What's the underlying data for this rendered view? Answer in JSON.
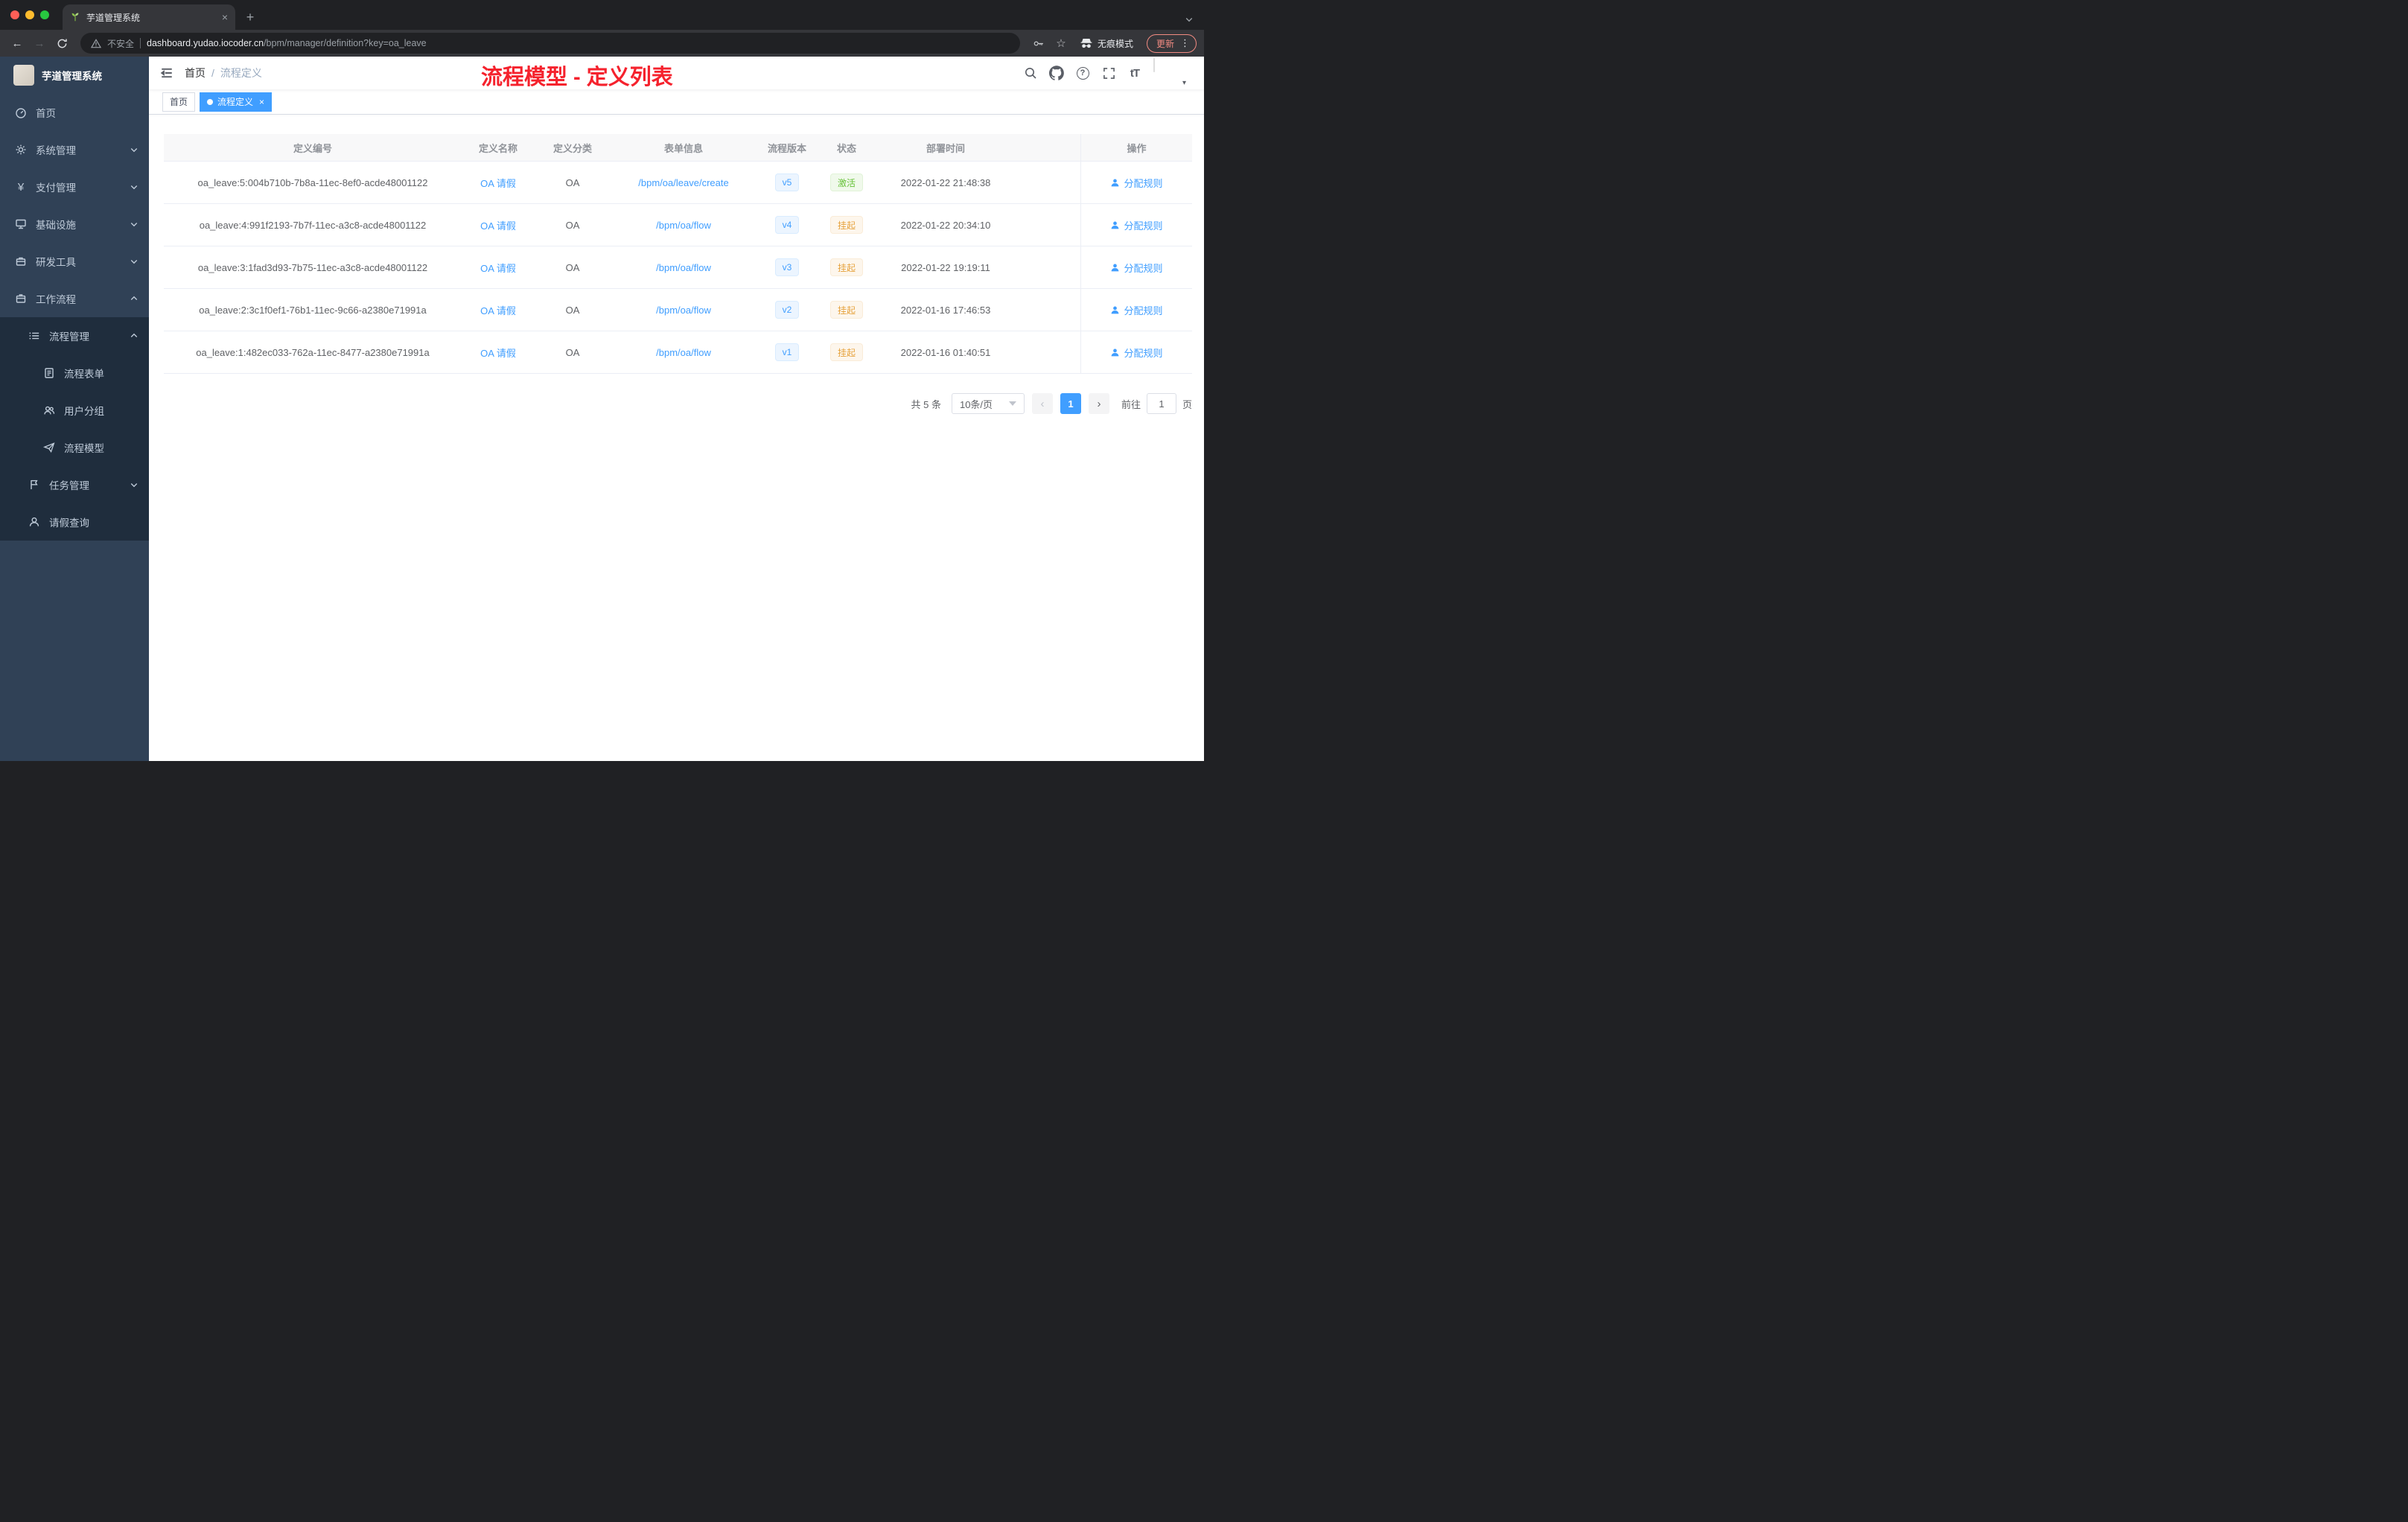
{
  "browser": {
    "tab_title": "芋道管理系统",
    "new_tab": "+",
    "security_label": "不安全",
    "url_host": "dashboard.yudao.iocoder.cn",
    "url_path": "/bpm/manager/definition?key=oa_leave",
    "incognito_label": "无痕模式",
    "update_label": "更新"
  },
  "sidebar": {
    "logo_title": "芋道管理系统",
    "items": [
      {
        "label": "首页"
      },
      {
        "label": "系统管理"
      },
      {
        "label": "支付管理"
      },
      {
        "label": "基础设施"
      },
      {
        "label": "研发工具"
      },
      {
        "label": "工作流程",
        "children": [
          {
            "label": "流程管理",
            "children": [
              {
                "label": "流程表单"
              },
              {
                "label": "用户分组"
              },
              {
                "label": "流程模型"
              }
            ]
          },
          {
            "label": "任务管理"
          },
          {
            "label": "请假查询"
          }
        ]
      }
    ]
  },
  "header": {
    "breadcrumb": [
      "首页",
      "流程定义"
    ],
    "annotation": "流程模型 - 定义列表"
  },
  "tags": [
    {
      "label": "首页",
      "active": false
    },
    {
      "label": "流程定义",
      "active": true
    }
  ],
  "table": {
    "columns": [
      "定义编号",
      "定义名称",
      "定义分类",
      "表单信息",
      "流程版本",
      "状态",
      "部署时间",
      "操作"
    ],
    "rows": [
      {
        "id": "oa_leave:5:004b710b-7b8a-11ec-8ef0-acde48001122",
        "name": "OA 请假",
        "category": "OA",
        "form": "/bpm/oa/leave/create",
        "version": "v5",
        "status": "激活",
        "status_type": "success",
        "deploy_time": "2022-01-22 21:48:38",
        "action": "分配规则"
      },
      {
        "id": "oa_leave:4:991f2193-7b7f-11ec-a3c8-acde48001122",
        "name": "OA 请假",
        "category": "OA",
        "form": "/bpm/oa/flow",
        "version": "v4",
        "status": "挂起",
        "status_type": "warning",
        "deploy_time": "2022-01-22 20:34:10",
        "action": "分配规则"
      },
      {
        "id": "oa_leave:3:1fad3d93-7b75-11ec-a3c8-acde48001122",
        "name": "OA 请假",
        "category": "OA",
        "form": "/bpm/oa/flow",
        "version": "v3",
        "status": "挂起",
        "status_type": "warning",
        "deploy_time": "2022-01-22 19:19:11",
        "action": "分配规则"
      },
      {
        "id": "oa_leave:2:3c1f0ef1-76b1-11ec-9c66-a2380e71991a",
        "name": "OA 请假",
        "category": "OA",
        "form": "/bpm/oa/flow",
        "version": "v2",
        "status": "挂起",
        "status_type": "warning",
        "deploy_time": "2022-01-16 17:46:53",
        "action": "分配规则"
      },
      {
        "id": "oa_leave:1:482ec033-762a-11ec-8477-a2380e71991a",
        "name": "OA 请假",
        "category": "OA",
        "form": "/bpm/oa/flow",
        "version": "v1",
        "status": "挂起",
        "status_type": "warning",
        "deploy_time": "2022-01-16 01:40:51",
        "action": "分配规则"
      }
    ]
  },
  "pagination": {
    "total": "共 5 条",
    "page_size": "10条/页",
    "prev": "‹",
    "current_page": "1",
    "next": "›",
    "goto_label": "前往",
    "goto_value": "1",
    "goto_suffix": "页"
  },
  "colors": {
    "accent": "#409eff",
    "success": "#67c23a",
    "warning": "#e6a23c",
    "annotation_red": "#f5222d",
    "sidebar_bg": "#304156",
    "submenu_bg": "#1f2d3d"
  }
}
